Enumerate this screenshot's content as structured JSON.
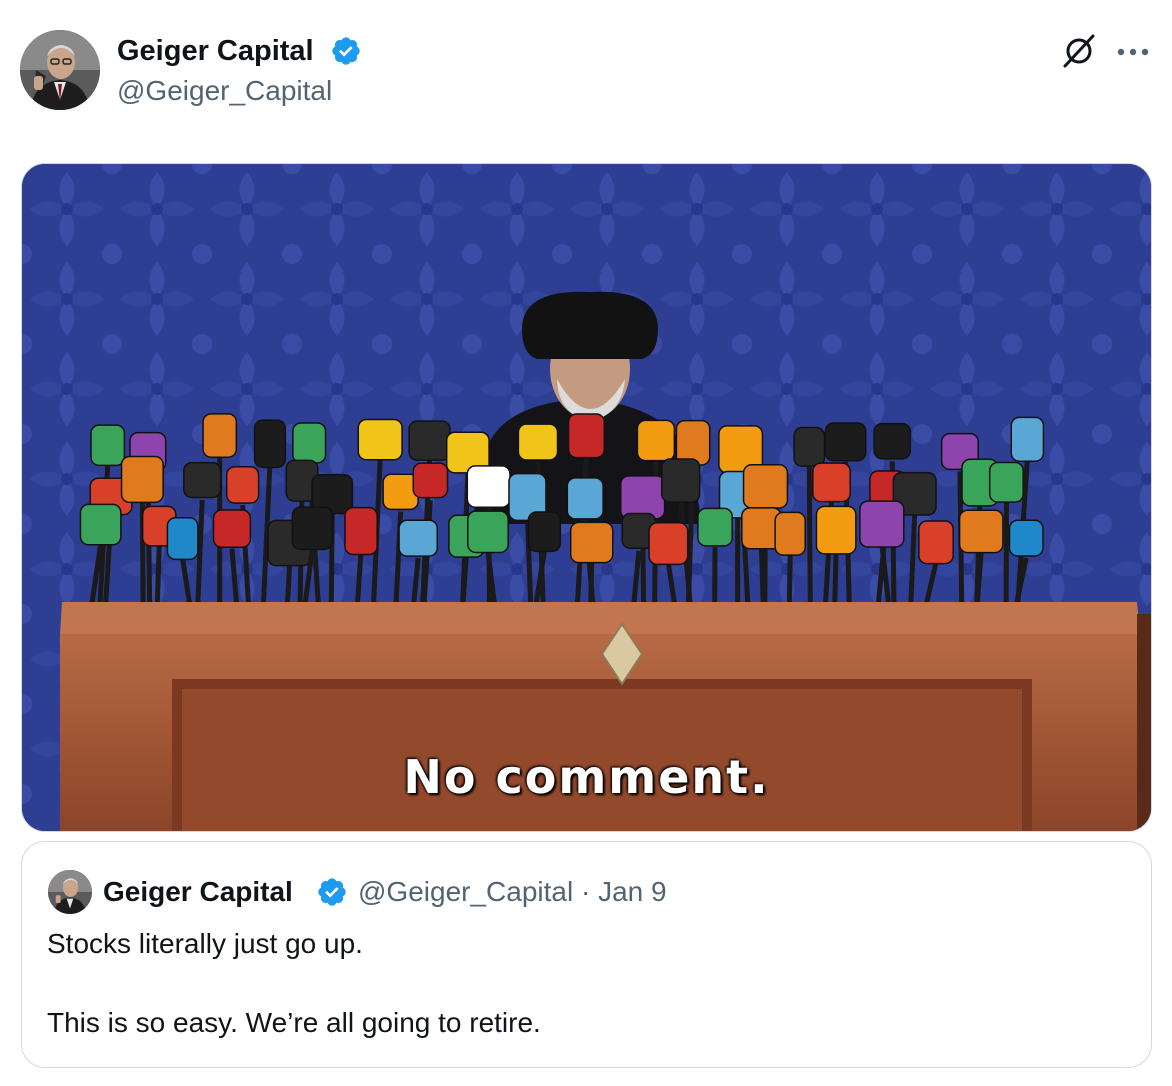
{
  "tweet": {
    "author": {
      "name": "Geiger Capital",
      "handle": "@Geiger_Capital",
      "verified": true,
      "avatar_icon": "avatar-portrait"
    },
    "actions": {
      "grok_icon": "grok-icon",
      "more_icon": "more-icon"
    },
    "media": {
      "caption": "No comment."
    },
    "quoted": {
      "name": "Geiger Capital",
      "handle": "@Geiger_Capital",
      "separator": "·",
      "date": "Jan 9",
      "verified": true,
      "text_line1": "Stocks literally just go up.",
      "text_line2": "This is so easy. We’re all going to retire."
    }
  },
  "colors": {
    "verified": "#1d9bf0",
    "text": "#0f1419",
    "secondary": "#536471",
    "border": "#cfd9de",
    "backdrop": "#2b3c8e",
    "podium": "#a8583a"
  }
}
